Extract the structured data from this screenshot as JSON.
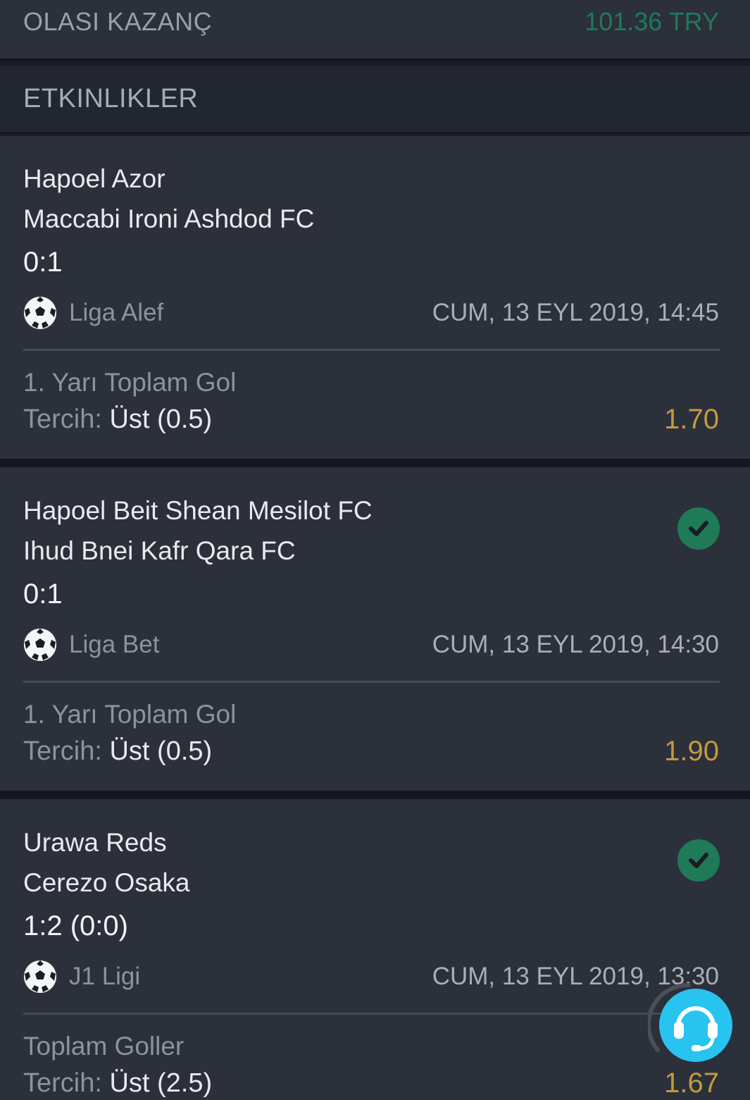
{
  "summary": {
    "label": "OLASI KAZANÇ",
    "value": "101.36 TRY",
    "value_color": "#1f7a58"
  },
  "section": {
    "title": "ETKINLIKLER"
  },
  "events": [
    {
      "home": "Hapoel Azor",
      "away": "Maccabi Ironi Ashdod FC",
      "score": "0:1",
      "sport_icon": "soccer-ball-icon",
      "league": "Liga Alef",
      "date": "CUM, 13 EYL 2019, 14:45",
      "market": "1. Yarı Toplam Gol",
      "pref_label": "Tercih: ",
      "pref_value": "Üst (0.5)",
      "odds": "1.70",
      "won": false
    },
    {
      "home": "Hapoel Beit Shean Mesilot FC",
      "away": "Ihud Bnei Kafr Qara FC",
      "score": "0:1",
      "sport_icon": "soccer-ball-icon",
      "league": "Liga Bet",
      "date": "CUM, 13 EYL 2019, 14:30",
      "market": "1. Yarı Toplam Gol",
      "pref_label": "Tercih: ",
      "pref_value": "Üst (0.5)",
      "odds": "1.90",
      "won": true
    },
    {
      "home": "Urawa Reds",
      "away": "Cerezo Osaka",
      "score": "1:2 (0:0)",
      "sport_icon": "soccer-ball-icon",
      "league": "J1 Ligi",
      "date": "CUM, 13 EYL 2019, 13:30",
      "market": "Toplam Goller",
      "pref_label": "Tercih: ",
      "pref_value": "Üst (2.5)",
      "odds": "1.67",
      "won": true
    }
  ],
  "colors": {
    "odds": "#c49a3c",
    "won_badge": "#1f7a58",
    "support_button": "#29c3f0"
  },
  "support": {
    "icon": "headset-support-icon"
  }
}
